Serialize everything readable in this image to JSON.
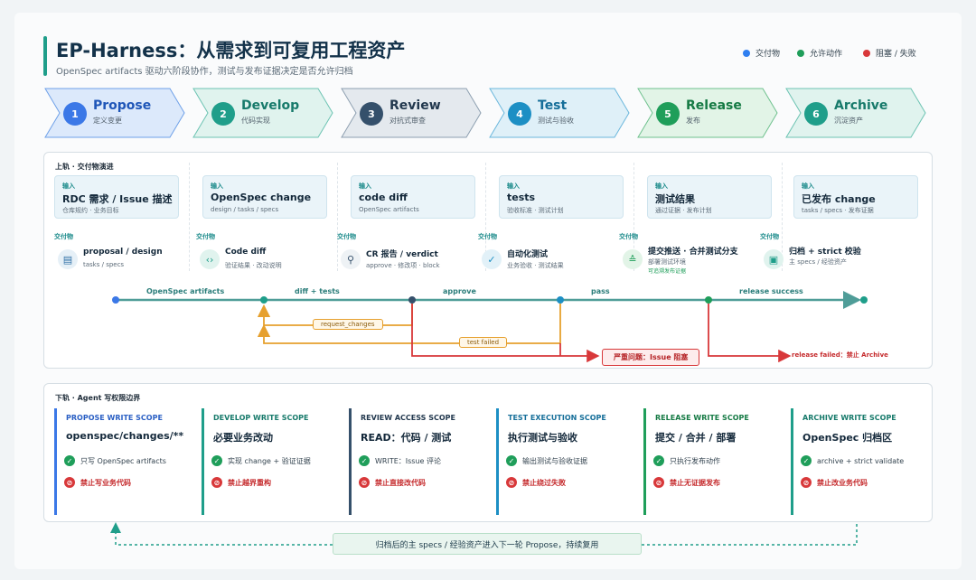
{
  "header": {
    "title": "EP-Harness：从需求到可复用工程资产",
    "subtitle": "OpenSpec artifacts 驱动六阶段协作，测试与发布证据决定是否允许归档"
  },
  "legend": [
    {
      "label": "交付物",
      "color": "#2f7ff0"
    },
    {
      "label": "允许动作",
      "color": "#1f9e5a"
    },
    {
      "label": "阻塞 / 失败",
      "color": "#d8383a"
    }
  ],
  "stages": [
    {
      "num": "1",
      "name": "Propose",
      "sub": "定义变更",
      "color": "#3b78e7",
      "fill": "#dce9fb"
    },
    {
      "num": "2",
      "name": "Develop",
      "sub": "代码实现",
      "color": "#1f9e8a",
      "fill": "#e0f3ee"
    },
    {
      "num": "3",
      "name": "Review",
      "sub": "对抗式审查",
      "color": "#35506b",
      "fill": "#e4e9ee"
    },
    {
      "num": "4",
      "name": "Test",
      "sub": "测试与验收",
      "color": "#1d8fc4",
      "fill": "#dff0f8"
    },
    {
      "num": "5",
      "name": "Release",
      "sub": "发布",
      "color": "#1f9e5a",
      "fill": "#e2f4e7"
    },
    {
      "num": "6",
      "name": "Archive",
      "sub": "沉淀资产",
      "color": "#1f9e8a",
      "fill": "#e0f3ee"
    }
  ],
  "upper": {
    "title": "上轨 · 交付物演进",
    "input_label": "输入",
    "deliverable_label": "交付物",
    "inputs": [
      {
        "main": "RDC 需求 / Issue 描述",
        "sub": "仓库规约 · 业务目标"
      },
      {
        "main": "OpenSpec change",
        "sub": "design / tasks / specs"
      },
      {
        "main": "code diff",
        "sub": "OpenSpec artifacts"
      },
      {
        "main": "tests",
        "sub": "验收标准 · 测试计划"
      },
      {
        "main": "测试结果",
        "sub": "通过证据 · 发布计划"
      },
      {
        "main": "已发布 change",
        "sub": "tasks / specs · 发布证据"
      }
    ],
    "deliverables": [
      {
        "icon": "document-icon",
        "glyph": "▤",
        "main": "proposal / design",
        "sub": "tasks / specs",
        "note": ""
      },
      {
        "icon": "code-icon",
        "glyph": "‹›",
        "main": "Code diff",
        "sub": "验证结果 · 改动说明",
        "note": ""
      },
      {
        "icon": "search-icon",
        "glyph": "⚲",
        "main": "CR 报告 / verdict",
        "sub": "approve · 修改项 · block",
        "note": ""
      },
      {
        "icon": "check-icon",
        "glyph": "✓",
        "main": "自动化测试",
        "sub": "业务验收 · 测试结果",
        "note": ""
      },
      {
        "icon": "deploy-icon",
        "glyph": "≙",
        "main": "提交推送 · 合并测试分支",
        "sub": "部署测试环境",
        "note": "可追溯发布证据"
      },
      {
        "icon": "archive-icon",
        "glyph": "▣",
        "main": "归档 + strict 校验",
        "sub": "主 specs / 经验资产",
        "note": ""
      }
    ],
    "flow_labels": [
      "OpenSpec artifacts",
      "diff + tests",
      "approve",
      "pass",
      "release success"
    ],
    "loop_labels": {
      "request": "request_changes",
      "test_failed": "test failed",
      "severe": "严重问题：Issue 阻塞",
      "release_failed": "release failed：禁止 Archive"
    }
  },
  "lower": {
    "title": "下轨 · Agent 写权限边界",
    "scopes": [
      {
        "head": "PROPOSE WRITE SCOPE",
        "main": "openspec/changes/**",
        "ok": "只写 OpenSpec artifacts",
        "no": "禁止写业务代码",
        "color": "#3b78e7"
      },
      {
        "head": "DEVELOP WRITE SCOPE",
        "main": "必要业务改动",
        "ok": "实现 change + 验证证据",
        "no": "禁止越界重构",
        "color": "#1f9e8a"
      },
      {
        "head": "REVIEW ACCESS SCOPE",
        "main": "READ：代码 / 测试",
        "ok": "WRITE：Issue 评论",
        "no": "禁止直接改代码",
        "color": "#35506b"
      },
      {
        "head": "TEST EXECUTION SCOPE",
        "main": "执行测试与验收",
        "ok": "输出测试与验收证据",
        "no": "禁止绕过失败",
        "color": "#1d8fc4"
      },
      {
        "head": "RELEASE WRITE SCOPE",
        "main": "提交 / 合并 / 部署",
        "ok": "只执行发布动作",
        "no": "禁止无证据发布",
        "color": "#1f9e5a"
      },
      {
        "head": "ARCHIVE WRITE SCOPE",
        "main": "OpenSpec 归档区",
        "ok": "archive + strict validate",
        "no": "禁止改业务代码",
        "color": "#1f9e8a"
      }
    ]
  },
  "footer": {
    "text": "归档后的主 specs / 经验资产进入下一轮 Propose，持续复用"
  }
}
